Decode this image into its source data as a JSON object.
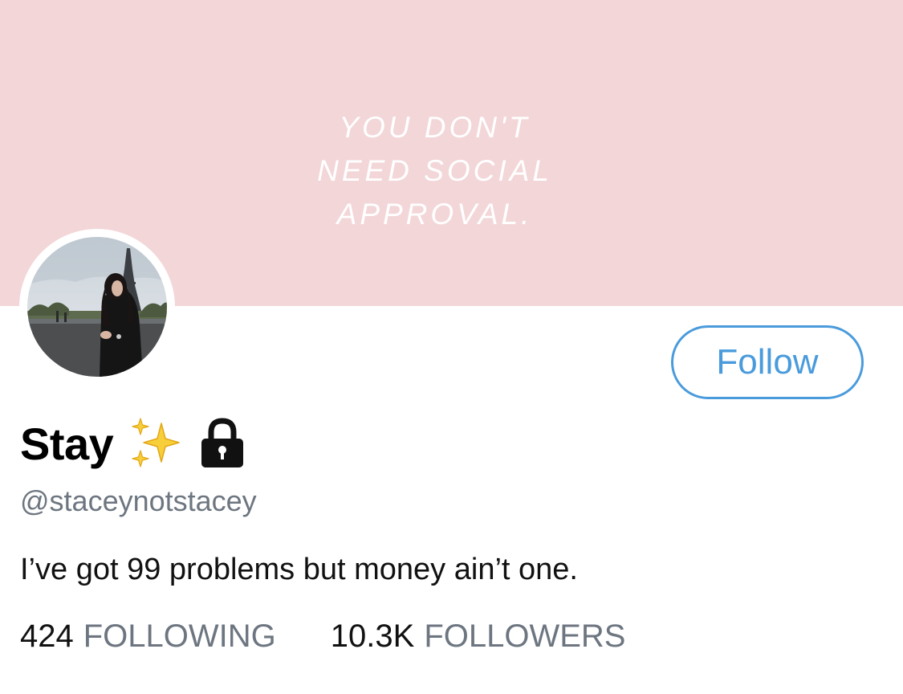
{
  "banner": {
    "quote": "YOU DON'T\nNEED SOCIAL\nAPPROVAL.",
    "background_color": "#f3d6d8"
  },
  "profile": {
    "display_name": "Stay",
    "name_icons": [
      "sparkles-icon",
      "lock-icon"
    ],
    "handle": "@staceynotstacey",
    "bio": "I’ve got 99 problems but money ain’t one.",
    "follow_label": "Follow",
    "accent_color": "#4a9bdc"
  },
  "stats": {
    "following_count": "424",
    "following_label": "FOLLOWING",
    "followers_count": "10.3K",
    "followers_label": "FOLLOWERS"
  }
}
